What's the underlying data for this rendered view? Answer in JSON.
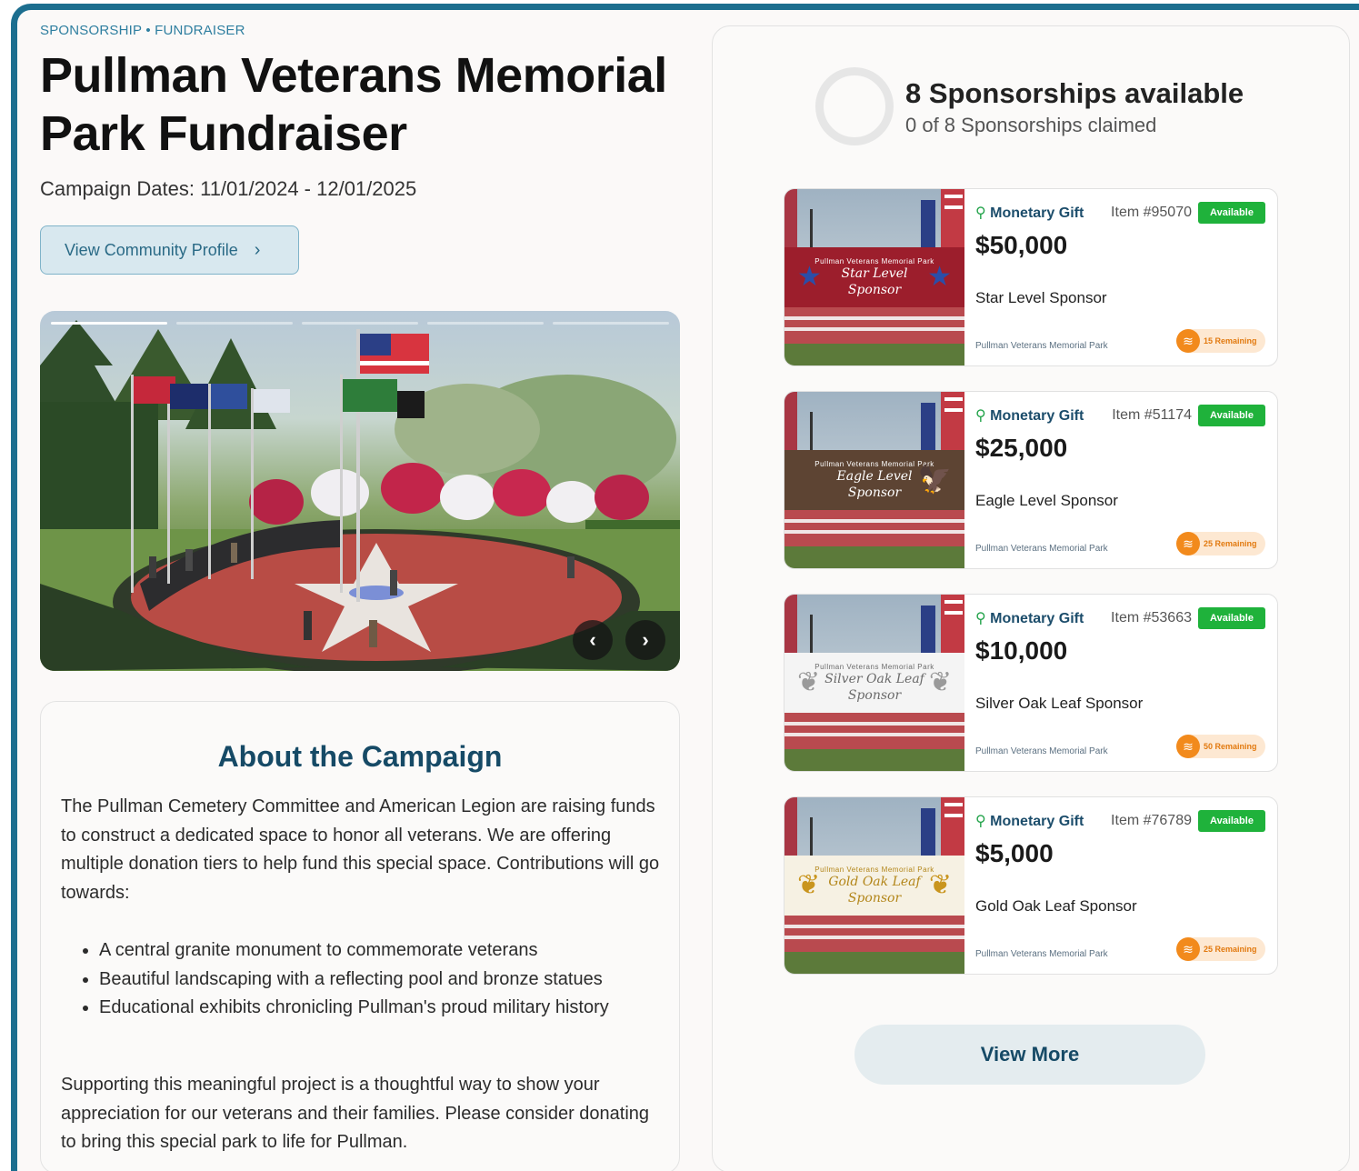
{
  "header": {
    "breadcrumb": "SPONSORSHIP • FUNDRAISER",
    "title": "Pullman Veterans Memorial Park Fundraiser",
    "dates": "Campaign Dates: 11/01/2024 - 12/01/2025",
    "profile_button": "View Community Profile",
    "profile_chevron": "›"
  },
  "gallery": {
    "slide_count": 5,
    "active_slide": 1,
    "prev_label": "‹",
    "next_label": "›"
  },
  "about": {
    "heading": "About the Campaign",
    "intro": "The Pullman Cemetery Committee and American Legion are raising funds to construct a dedicated space to honor all veterans. We are offering multiple donation tiers to help fund this special space. Contributions will go towards:",
    "bullets": [
      "A central granite monument to commemorate veterans",
      "Beautiful landscaping with a reflecting pool and bronze statues",
      "Educational exhibits chronicling Pullman's proud military history"
    ],
    "closing": "Supporting this meaningful project is a thoughtful way to show your appreciation for our veterans and their families. Please consider donating to bring this special park to life for Pullman."
  },
  "sponsorships": {
    "title": "8 Sponsorships available",
    "subtitle": "0 of 8 Sponsorships claimed",
    "claimed_fraction": 0,
    "items": [
      {
        "type": "Monetary Gift",
        "item_no": "Item #95070",
        "status": "Available",
        "amount": "$50,000",
        "name": "Star Level Sponsor",
        "org": "Pullman Veterans Memorial Park",
        "remaining": "15 Remaining",
        "banner_small": "Pullman Veterans Memorial Park",
        "banner_line1": "Star Level",
        "banner_line2": "Sponsor",
        "banner_color": "#9c1e2c",
        "banner_text_color": "#ffffff",
        "emblem_left": "★",
        "emblem_right": "★",
        "emblem_color": "#2b4ea8"
      },
      {
        "type": "Monetary Gift",
        "item_no": "Item #51174",
        "status": "Available",
        "amount": "$25,000",
        "name": "Eagle Level Sponsor",
        "org": "Pullman Veterans Memorial Park",
        "remaining": "25 Remaining",
        "banner_small": "Pullman Veterans Memorial Park",
        "banner_line1": "Eagle Level",
        "banner_line2": "Sponsor",
        "banner_color": "#5d4433",
        "banner_text_color": "#ffffff",
        "emblem_left": "",
        "emblem_right": "🦅",
        "emblem_color": "#ffffff"
      },
      {
        "type": "Monetary Gift",
        "item_no": "Item #53663",
        "status": "Available",
        "amount": "$10,000",
        "name": "Silver Oak Leaf Sponsor",
        "org": "Pullman Veterans Memorial Park",
        "remaining": "50 Remaining",
        "banner_small": "Pullman Veterans Memorial Park",
        "banner_line1": "Silver Oak Leaf",
        "banner_line2": "Sponsor",
        "banner_color": "#f4f4f4",
        "banner_text_color": "#6b6b6b",
        "emblem_left": "❦",
        "emblem_right": "❦",
        "emblem_color": "#9a9a9a"
      },
      {
        "type": "Monetary Gift",
        "item_no": "Item #76789",
        "status": "Available",
        "amount": "$5,000",
        "name": "Gold Oak Leaf Sponsor",
        "org": "Pullman Veterans Memorial Park",
        "remaining": "25 Remaining",
        "banner_small": "Pullman Veterans Memorial Park",
        "banner_line1": "Gold Oak Leaf",
        "banner_line2": "Sponsor",
        "banner_color": "#f6f1e3",
        "banner_text_color": "#b3861a",
        "emblem_left": "❦",
        "emblem_right": "❦",
        "emblem_color": "#c9951e"
      }
    ],
    "view_more": "View More"
  },
  "colors": {
    "accent": "#1c6e8f",
    "heading": "#164a66",
    "available_green": "#1fb23b",
    "remaining_orange": "#f28a1c"
  }
}
